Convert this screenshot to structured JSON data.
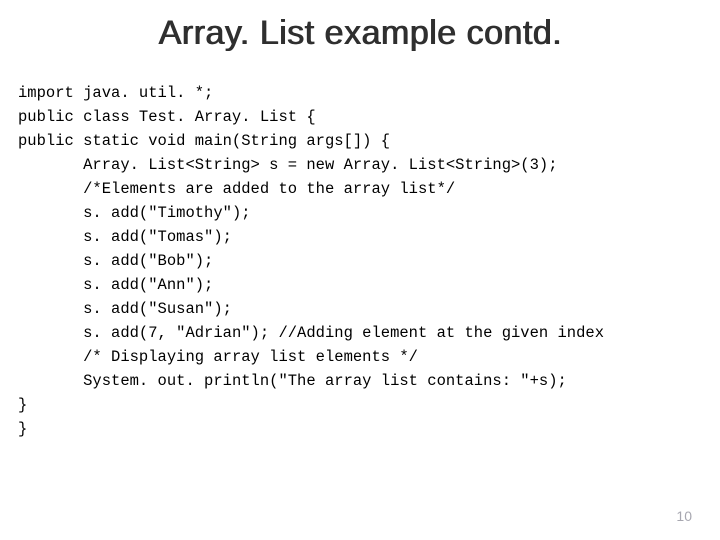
{
  "title": "Array. List example contd.",
  "code": {
    "l1": "import java. util. *;",
    "l2": "public class Test. Array. List {",
    "l3": "public static void main(String args[]) {",
    "l4": "Array. List<String> s = new Array. List<String>(3);",
    "l5": "/*Elements are added to the array list*/",
    "l6": "s. add(\"Timothy\");",
    "l7": "s. add(\"Tomas\");",
    "l8": "s. add(\"Bob\");",
    "l9": "s. add(\"Ann\");",
    "l10": "s. add(\"Susan\");",
    "l11": "s. add(7, \"Adrian\"); //Adding element at the given index",
    "l12": "/* Displaying array list elements */",
    "l13": "System. out. println(\"The array list contains: \"+s);",
    "l14": "}",
    "l15": "}"
  },
  "slide_number": "10"
}
